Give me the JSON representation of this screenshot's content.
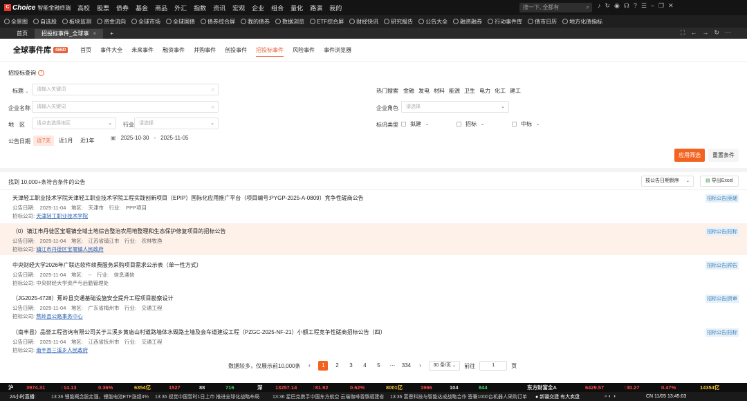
{
  "app": {
    "brand": "Choice",
    "brand_sub": "智能金融终端",
    "logo_mark": "C"
  },
  "menu": [
    "高校",
    "股票",
    "债券",
    "基金",
    "商品",
    "外汇",
    "指数",
    "资讯",
    "宏观",
    "企业",
    "组合",
    "量化",
    "路演",
    "我的"
  ],
  "search": {
    "placeholder": "搜一下, 全都有"
  },
  "toolbar": [
    "全景图",
    "自选股",
    "板块监测",
    "资金流向",
    "全球市场",
    "全球国债",
    "债券综合屏",
    "我的债券",
    "数据浏览",
    "ETF综合屏",
    "财经快讯",
    "研究报告",
    "公告大全",
    "融资融券",
    "行动事件库",
    "债市日历",
    "地方化债指标"
  ],
  "tabs": [
    {
      "label": "首页"
    },
    {
      "label": "招投标事件_全球事"
    }
  ],
  "page": {
    "brand": "全球事件库",
    "badge": "GED"
  },
  "subnav": [
    "首页",
    "事件大全",
    "未来事件",
    "融资事件",
    "并购事件",
    "创投事件",
    "招投标事件",
    "风险事件",
    "事件浏览器"
  ],
  "query": {
    "title": "招投标查询",
    "field_label": "标题",
    "keyword_placeholder": "请输入关键词",
    "company_label": "企业名称",
    "company_placeholder": "请输入关键词",
    "region_label": "地　区",
    "region_placeholder": "请点击选择地区",
    "industry_label": "行业",
    "industry_placeholder": "请选择",
    "hot_label": "热门搜索",
    "hot": [
      "金融",
      "发电",
      "材料",
      "能源",
      "卫生",
      "电力",
      "化工",
      "建工"
    ],
    "role_label": "企业角色",
    "role_placeholder": "请选择",
    "type_label": "标讯类型",
    "types": [
      "拟建",
      "招标",
      "中标"
    ],
    "date_label": "公告日期",
    "date_pills": [
      "近7天",
      "近1月",
      "近1年"
    ],
    "date_from": "2025-10-30",
    "date_sep": "-",
    "date_to": "2025-11-05",
    "apply": "应用筛选",
    "reset": "重置条件"
  },
  "results": {
    "count_text": "找到 10,000+条符合条件的公告",
    "sort": "按公告日期倒序",
    "export": "导出Excel",
    "items": [
      {
        "title": "天津轻工职业技术学院天津轻工职业技术学院工程实践创新项目（EPIP）国际化应用推广平台（项目编号:PYGP-2025-A-0809）竞争性磋商公告",
        "meta": "公告日期:　2025-11-04　地区:　天津市　行业:　PPP项目",
        "party_label": "招标公司:",
        "party": "天津轻工职业技术学院",
        "tag": "招标公告|竞磋",
        "highlight": false
      },
      {
        "title": "（0）镇江市丹徒区宝堰镇全域土地综合整治农用地整理和生态保护修复项目的招标公告",
        "meta": "公告日期:　2025-11-04　地区:　江苏省镇江市　行业:　农林牧渔",
        "party_label": "招标公司:",
        "party": "镇江市丹徒区宝堰镇人民政府",
        "tag": "招标公告|招标",
        "highlight": true
      },
      {
        "title": "中央财经大学2026年广联达软件续费服务采购项目需求公示表（单一性方式）",
        "meta": "公告日期:　2025-11-04　地区:　--　行业:　信息通信",
        "party_label": "招标公司:",
        "party": "中央财经大学资产与后勤管理处",
        "tag": "招标公告|预告",
        "highlight": false
      },
      {
        "title": "（JG2025-4728）蕉岭县交通基础设施安全提升工程项目勘察设计",
        "meta": "公告日期:　2025-11-04　地区:　广东省梅州市　行业:　交通工程",
        "party_label": "招标公司:",
        "party": "蕉岭县公路事务中心",
        "tag": "招标公告|资审",
        "highlight": false
      },
      {
        "title": "（南丰县）品誉工程咨询有限公司关于三溪乡黄庙山村道路墙体水毁路土墙及会车道建设工程（PZGC-2025-NF-21）小额工程竞争性磋商招标公告（四）",
        "meta": "公告日期:　2025-11-04　地区:　江西省抚州市　行业:　交通工程",
        "party_label": "招标公司:",
        "party": "南丰县三溪乡人民政府",
        "tag": "招标公告|招标",
        "highlight": false
      }
    ]
  },
  "pager": {
    "note": "数据较多，仅展示前10,000条",
    "prev": "‹",
    "pages": [
      "1",
      "2",
      "3",
      "4",
      "5"
    ],
    "ellipsis": "···",
    "last": "334",
    "next": "›",
    "per_page": "30 条/页",
    "goto_label": "前往",
    "goto_value": "1",
    "page_unit": "页"
  },
  "ticker": {
    "sh": "沪",
    "sh_val": "3974.31",
    "sh_chg": "↑14.13",
    "sh_pct": "0.36%",
    "sh_amt": "6354亿",
    "sh_up": "1527",
    "sh_flat": "88",
    "sh_down": "716",
    "sz": "深",
    "sz_val": "13257.14",
    "sz_chg": "↑81.92",
    "sz_pct": "0.62%",
    "sz_amt": "8001亿",
    "sz_up": "1966",
    "sz_flat": "104",
    "sz_down": "844",
    "stock": "东方财富全A",
    "stock_val": "6429.57",
    "stock_chg": "↑30.27",
    "stock_pct": "0.47%",
    "stock_amt": "14354亿"
  },
  "news": {
    "label": "24小时直播:",
    "items": [
      "13:36 锂能概念股走强，锂能电池ETF涨超4%",
      "13:36 视觉中国暂时1日上市 推进全球化战略布局",
      "13:36 星巴克携手中国东方航空 云端咖啡香飘福建省",
      "13:36 富恩科技与智能达成战略合作 签署1000台机器人采购订单"
    ],
    "tail": "● 新疆交建 有大卖盘",
    "clock": "CN 11/05 13:45:03"
  }
}
